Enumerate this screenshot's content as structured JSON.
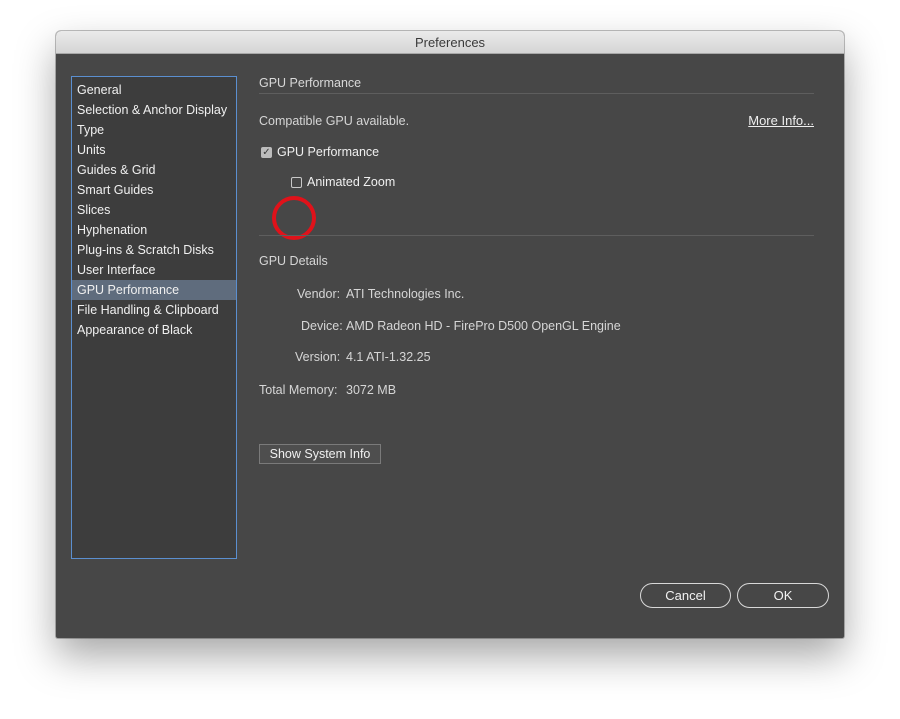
{
  "window": {
    "title": "Preferences"
  },
  "sidebar": {
    "items": [
      {
        "label": "General"
      },
      {
        "label": "Selection & Anchor Display"
      },
      {
        "label": "Type"
      },
      {
        "label": "Units"
      },
      {
        "label": "Guides & Grid"
      },
      {
        "label": "Smart Guides"
      },
      {
        "label": "Slices"
      },
      {
        "label": "Hyphenation"
      },
      {
        "label": "Plug-ins & Scratch Disks"
      },
      {
        "label": "User Interface"
      },
      {
        "label": "GPU Performance",
        "selected": true
      },
      {
        "label": "File Handling & Clipboard"
      },
      {
        "label": "Appearance of Black"
      }
    ]
  },
  "gpu_performance": {
    "heading": "GPU Performance",
    "status_text": "Compatible GPU available.",
    "more_info_label": "More Info...",
    "gpu_checkbox": {
      "label": "GPU Performance",
      "checked": true
    },
    "animated_zoom_checkbox": {
      "label": "Animated Zoom",
      "checked": false
    }
  },
  "gpu_details": {
    "heading": "GPU Details",
    "vendor_label": "Vendor:",
    "vendor_value": "ATI Technologies Inc.",
    "device_label": "Device:",
    "device_value": "AMD Radeon HD - FirePro D500 OpenGL Engine",
    "version_label": "Version:",
    "version_value": "4.1 ATI-1.32.25",
    "memory_label": "Total Memory:",
    "memory_value": "3072 MB",
    "system_info_button": "Show System Info"
  },
  "footer": {
    "cancel_label": "Cancel",
    "ok_label": "OK"
  },
  "colors": {
    "window_bg": "#474747",
    "selection_bg": "#5f6c7d",
    "annotation_circle": "#e0121a",
    "sidebar_border": "#5b8fd0"
  }
}
